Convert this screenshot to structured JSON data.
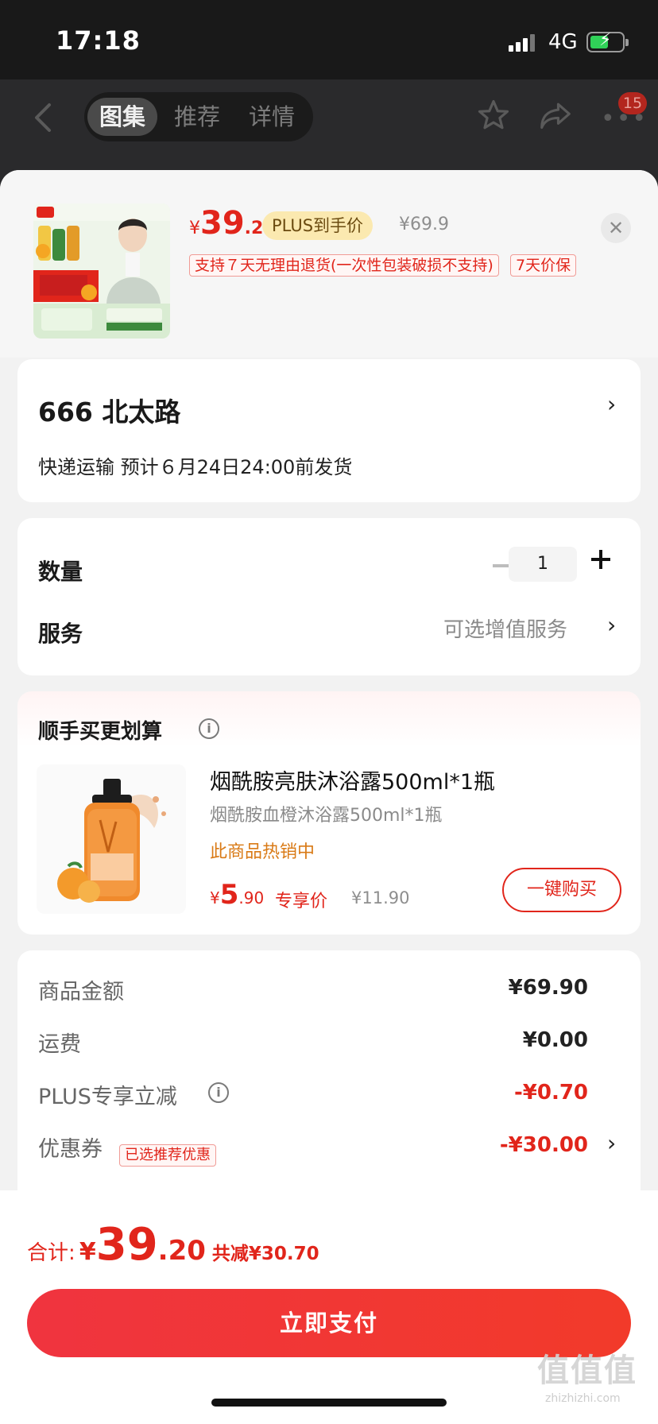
{
  "status_bar": {
    "time": "17:18",
    "network": "4G"
  },
  "nav": {
    "tabs": [
      {
        "label": "图集"
      },
      {
        "label": "推荐"
      },
      {
        "label": "详情"
      }
    ],
    "message_count": "15"
  },
  "product": {
    "price_symbol": "¥",
    "price_int": "39",
    "price_dec": ".2",
    "plus_label": "PLUS到手价",
    "original_price": "¥69.9",
    "tags": [
      "支持７天无理由退货(一次性包装破损不支持)",
      "7天价保"
    ]
  },
  "address": {
    "line": "666  北太路",
    "shipping": "快递运输 预计６月24日24:00前发货"
  },
  "quantity": {
    "label": "数量",
    "value": "1"
  },
  "service": {
    "label": "服务",
    "value": "可选增值服务"
  },
  "deal": {
    "title": "顺手买更划算",
    "name": "烟酰胺亮肤沐浴露500ml*1瓶",
    "subname": "烟酰胺血橙沐浴露500ml*1瓶",
    "hot": "此商品热销中",
    "price_symbol": "¥",
    "price_int": "5",
    "price_dec": ".90",
    "exclusive": "专享价",
    "original": "¥11.90",
    "buy_label": "一键购买"
  },
  "summary": {
    "rows": [
      {
        "label": "商品金额",
        "value": "¥69.90"
      },
      {
        "label": "运费",
        "value": "¥0.00"
      },
      {
        "label": "PLUS专享立减",
        "value": "-¥0.70"
      },
      {
        "label": "优惠券",
        "value": "-¥30.00",
        "tag": "已选推荐优惠"
      }
    ]
  },
  "footer": {
    "total_label": "合计:",
    "total_symbol": "¥",
    "total_int": "39",
    "total_dec": ".20",
    "saving": "共减¥30.70",
    "pay_label": "立即支付"
  },
  "watermark": {
    "text": "值值值",
    "sub": "zhizhizhi.com"
  },
  "colors": {
    "accent": "#e1251b",
    "pay_button": "#f0343f",
    "plus_tag": "#fbe9b0"
  },
  "icons": [
    "back-arrow-icon",
    "star-icon",
    "share-icon",
    "more-icon",
    "close-icon",
    "chevron-right-icon",
    "info-icon",
    "minus-icon",
    "plus-icon"
  ]
}
